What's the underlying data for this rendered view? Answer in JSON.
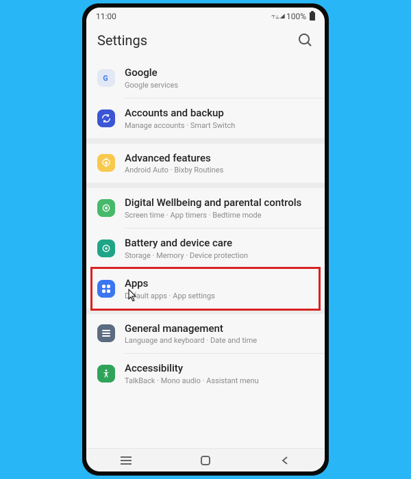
{
  "status": {
    "time": "11:00",
    "icons": "⥾ ⥿ ◢",
    "battery_text": "100%"
  },
  "header": {
    "title": "Settings"
  },
  "items": [
    {
      "title": "Google",
      "sub": "Google services"
    },
    {
      "title": "Accounts and backup",
      "sub": "Manage accounts · Smart Switch"
    },
    {
      "title": "Advanced features",
      "sub": "Android Auto · Bixby Routines"
    },
    {
      "title": "Digital Wellbeing and parental controls",
      "sub": "Screen time · App timers · Bedtime mode"
    },
    {
      "title": "Battery and device care",
      "sub": "Storage · Memory · Device protection"
    },
    {
      "title": "Apps",
      "sub": "Default apps · App settings"
    },
    {
      "title": "General management",
      "sub": "Language and keyboard · Date and time"
    },
    {
      "title": "Accessibility",
      "sub": "TalkBack · Mono audio · Assistant menu"
    }
  ]
}
